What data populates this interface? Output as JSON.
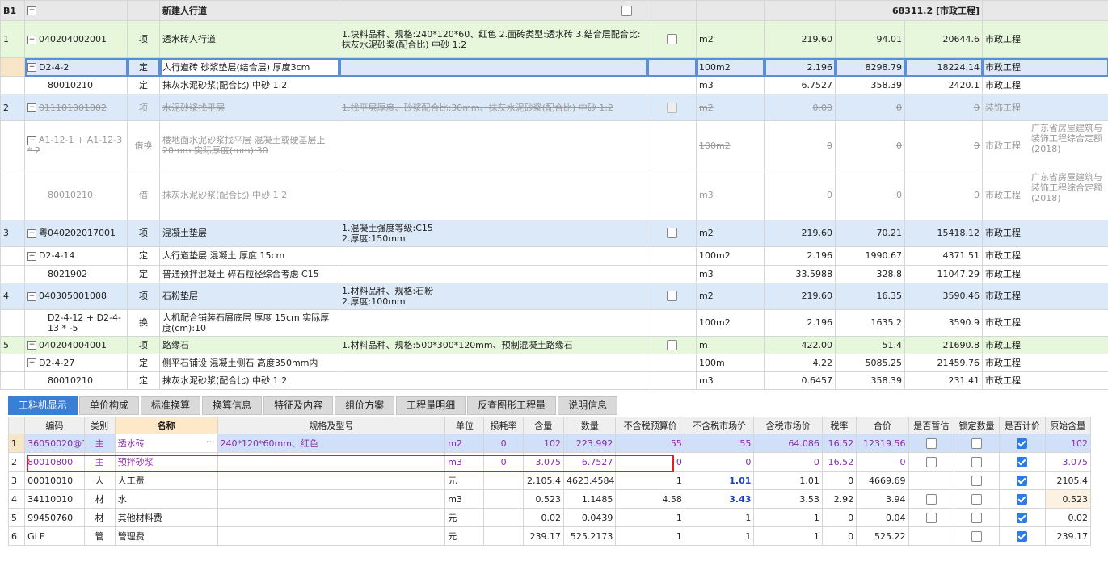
{
  "top": {
    "header": {
      "code": "B1",
      "title": "新建人行道",
      "total": "68311.2",
      "category": "[市政工程]"
    },
    "rows": [
      {
        "seq": "1",
        "code": "040204002001",
        "type": "项",
        "name": "透水砖人行道",
        "feature": "1.块料品种、规格:240*120*60、红色\n2.面砖类型:透水砖\n3.结合层配合比:抹灰水泥砂浆(配合比) 中砂 1:2",
        "unit": "m2",
        "qty": "219.60",
        "price": "94.01",
        "total": "20644.6",
        "major": "市政工程",
        "note": ""
      },
      {
        "seq": "",
        "code": "D2-4-2",
        "type": "定",
        "name": "人行道砖 砂浆垫层(结合层) 厚度3cm",
        "feature": "",
        "unit": "100m2",
        "qty": "2.196",
        "price": "8298.79",
        "total": "18224.14",
        "major": "市政工程",
        "note": ""
      },
      {
        "seq": "",
        "code": "80010210",
        "type": "定",
        "name": "抹灰水泥砂浆(配合比) 中砂 1:2",
        "feature": "",
        "unit": "m3",
        "qty": "6.7527",
        "price": "358.39",
        "total": "2420.1",
        "major": "市政工程",
        "note": ""
      },
      {
        "seq": "2",
        "code": "011101001002",
        "type": "项",
        "name": "水泥砂浆找平层",
        "feature": "1.找平层厚度、砂浆配合比:30mm、抹灰水泥砂浆(配合比) 中砂 1:2",
        "unit": "m2",
        "qty": "0.00",
        "price": "0",
        "total": "0",
        "major": "装饰工程",
        "note": ""
      },
      {
        "seq": "",
        "code": "A1-12-1 + A1-12-3 * 2",
        "type": "借换",
        "name": "楼地面水泥砂浆找平层 混凝土或硬基层上 20mm 实际厚度(mm):30",
        "feature": "",
        "unit": "100m2",
        "qty": "0",
        "price": "0",
        "total": "0",
        "major": "市政工程",
        "note": "广东省房屋建筑与装饰工程综合定额(2018)"
      },
      {
        "seq": "",
        "code": "80010210",
        "type": "借",
        "name": "抹灰水泥砂浆(配合比) 中砂 1:2",
        "feature": "",
        "unit": "m3",
        "qty": "0",
        "price": "0",
        "total": "0",
        "major": "市政工程",
        "note": "广东省房屋建筑与装饰工程综合定额(2018)"
      },
      {
        "seq": "3",
        "code": "粤040202017001",
        "type": "项",
        "name": "混凝土垫层",
        "feature": "1.混凝土强度等级:C15\n2.厚度:150mm",
        "unit": "m2",
        "qty": "219.60",
        "price": "70.21",
        "total": "15418.12",
        "major": "市政工程",
        "note": ""
      },
      {
        "seq": "",
        "code": "D2-4-14",
        "type": "定",
        "name": "人行道垫层 混凝土 厚度 15cm",
        "feature": "",
        "unit": "100m2",
        "qty": "2.196",
        "price": "1990.67",
        "total": "4371.51",
        "major": "市政工程",
        "note": ""
      },
      {
        "seq": "",
        "code": "8021902",
        "type": "定",
        "name": "普通预拌混凝土 碎石粒径综合考虑 C15",
        "feature": "",
        "unit": "m3",
        "qty": "33.5988",
        "price": "328.8",
        "total": "11047.29",
        "major": "市政工程",
        "note": ""
      },
      {
        "seq": "4",
        "code": "040305001008",
        "type": "项",
        "name": "石粉垫层",
        "feature": "1.材料品种、规格:石粉\n2.厚度:100mm",
        "unit": "m2",
        "qty": "219.60",
        "price": "16.35",
        "total": "3590.46",
        "major": "市政工程",
        "note": ""
      },
      {
        "seq": "",
        "code": "D2-4-12 + D2-4-13 * -5",
        "type": "换",
        "name": "人机配合铺装石屑底层 厚度 15cm 实际厚度(cm):10",
        "feature": "",
        "unit": "100m2",
        "qty": "2.196",
        "price": "1635.2",
        "total": "3590.9",
        "major": "市政工程",
        "note": ""
      },
      {
        "seq": "5",
        "code": "040204004001",
        "type": "项",
        "name": "路缘石",
        "feature": "1.材料品种、规格:500*300*120mm、预制混凝土路缘石",
        "unit": "m",
        "qty": "422.00",
        "price": "51.4",
        "total": "21690.8",
        "major": "市政工程",
        "note": ""
      },
      {
        "seq": "",
        "code": "D2-4-27",
        "type": "定",
        "name": "侧平石铺设 混凝土侧石 高度350mm内",
        "feature": "",
        "unit": "100m",
        "qty": "4.22",
        "price": "5085.25",
        "total": "21459.76",
        "major": "市政工程",
        "note": ""
      },
      {
        "seq": "",
        "code": "80010210",
        "type": "定",
        "name": "抹灰水泥砂浆(配合比) 中砂 1:2",
        "feature": "",
        "unit": "m3",
        "qty": "0.6457",
        "price": "358.39",
        "total": "231.41",
        "major": "市政工程",
        "note": ""
      }
    ]
  },
  "tabs": [
    "工料机显示",
    "单价构成",
    "标准换算",
    "换算信息",
    "特征及内容",
    "组价方案",
    "工程量明细",
    "反查图形工程量",
    "说明信息"
  ],
  "bottom": {
    "headers": [
      "编码",
      "类别",
      "名称",
      "规格及型号",
      "单位",
      "损耗率",
      "含量",
      "数量",
      "不含税预算价",
      "不含税市场价",
      "含税市场价",
      "税率",
      "合价",
      "是否暂估",
      "锁定数量",
      "是否计价",
      "原始含量"
    ],
    "rows": [
      {
        "idx": "1",
        "code": "36050020@1",
        "cat": "主",
        "name": "透水砖",
        "spec": "240*120*60mm、红色",
        "unit": "m2",
        "loss": "0",
        "content": "102",
        "qty": "223.992",
        "budget": "55",
        "market": "55",
        "tax_market": "64.086",
        "tax": "16.52",
        "total": "12319.56",
        "orig": "102"
      },
      {
        "idx": "2",
        "code": "80010800",
        "cat": "主",
        "name": "预拌砂浆",
        "spec": "",
        "unit": "m3",
        "loss": "0",
        "content": "3.075",
        "qty": "6.7527",
        "budget": "0",
        "market": "0",
        "tax_market": "0",
        "tax": "16.52",
        "total": "0",
        "orig": "3.075"
      },
      {
        "idx": "3",
        "code": "00010010",
        "cat": "人",
        "name": "人工费",
        "spec": "",
        "unit": "元",
        "loss": "",
        "content": "2,105.4",
        "qty": "4623.4584",
        "budget": "1",
        "market": "1.01",
        "tax_market": "1.01",
        "tax": "0",
        "total": "4669.69",
        "orig": "2105.4"
      },
      {
        "idx": "4",
        "code": "34110010",
        "cat": "材",
        "name": "水",
        "spec": "",
        "unit": "m3",
        "loss": "",
        "content": "0.523",
        "qty": "1.1485",
        "budget": "4.58",
        "market": "3.43",
        "tax_market": "3.53",
        "tax": "2.92",
        "total": "3.94",
        "orig": "0.523"
      },
      {
        "idx": "5",
        "code": "99450760",
        "cat": "材",
        "name": "其他材料费",
        "spec": "",
        "unit": "元",
        "loss": "",
        "content": "0.02",
        "qty": "0.0439",
        "budget": "1",
        "market": "1",
        "tax_market": "1",
        "tax": "0",
        "total": "0.04",
        "orig": "0.02"
      },
      {
        "idx": "6",
        "code": "GLF",
        "cat": "管",
        "name": "管理费",
        "spec": "",
        "unit": "元",
        "loss": "",
        "content": "239.17",
        "qty": "525.2173",
        "budget": "1",
        "market": "1",
        "tax_market": "1",
        "tax": "0",
        "total": "525.22",
        "orig": "239.17"
      }
    ]
  }
}
